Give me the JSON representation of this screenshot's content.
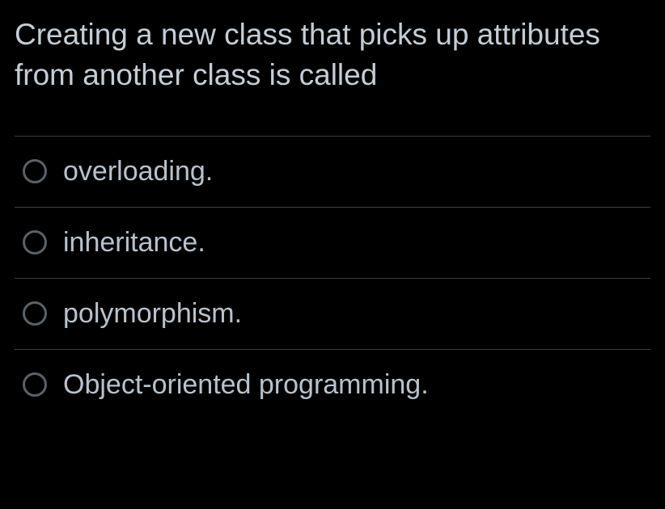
{
  "question": "Creating a new class that picks up attributes from another class is called",
  "options": [
    {
      "label": "overloading."
    },
    {
      "label": "inheritance."
    },
    {
      "label": "polymorphism."
    },
    {
      "label": "Object-oriented programming."
    }
  ]
}
